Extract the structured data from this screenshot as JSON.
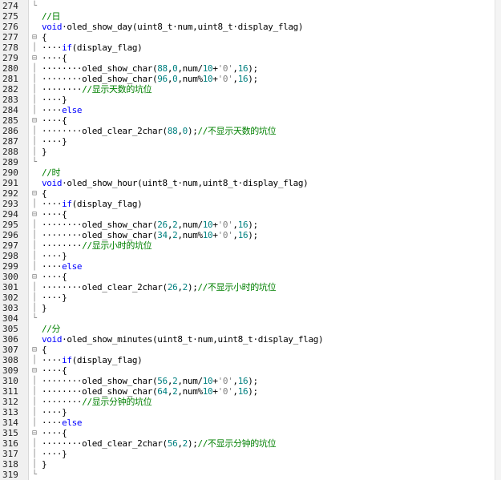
{
  "colors": {
    "keyword": "#0000ff",
    "comment": "#008000",
    "number": "#008080",
    "string": "#808080",
    "text": "#000000",
    "gutter_bg": "#f0f0f0"
  },
  "editor": {
    "lines": [
      {
        "n": "274",
        "fold": "└",
        "tokens": []
      },
      {
        "n": "275",
        "fold": "",
        "tokens": [
          {
            "t": "//日",
            "c": "c"
          }
        ]
      },
      {
        "n": "276",
        "fold": "",
        "tokens": [
          {
            "t": "void",
            "c": "k"
          },
          {
            "t": "·oled_show_day(uint8_t·num,uint8_t·display_flag)",
            "c": "p"
          }
        ]
      },
      {
        "n": "277",
        "fold": "⊟",
        "tokens": [
          {
            "t": "{",
            "c": "p"
          }
        ]
      },
      {
        "n": "278",
        "fold": "│",
        "tokens": [
          {
            "t": "····",
            "c": "p"
          },
          {
            "t": "if",
            "c": "k"
          },
          {
            "t": "(display_flag)",
            "c": "p"
          }
        ]
      },
      {
        "n": "279",
        "fold": "⊟",
        "tokens": [
          {
            "t": "····{",
            "c": "p"
          }
        ]
      },
      {
        "n": "280",
        "fold": "│",
        "tokens": [
          {
            "t": "········oled_show_char(",
            "c": "p"
          },
          {
            "t": "88",
            "c": "n"
          },
          {
            "t": ",",
            "c": "p"
          },
          {
            "t": "0",
            "c": "n"
          },
          {
            "t": ",num/",
            "c": "p"
          },
          {
            "t": "10",
            "c": "n"
          },
          {
            "t": "+",
            "c": "p"
          },
          {
            "t": "'0'",
            "c": "s"
          },
          {
            "t": ",",
            "c": "p"
          },
          {
            "t": "16",
            "c": "n"
          },
          {
            "t": ");",
            "c": "p"
          }
        ]
      },
      {
        "n": "281",
        "fold": "│",
        "tokens": [
          {
            "t": "········oled_show_char(",
            "c": "p"
          },
          {
            "t": "96",
            "c": "n"
          },
          {
            "t": ",",
            "c": "p"
          },
          {
            "t": "0",
            "c": "n"
          },
          {
            "t": ",num%",
            "c": "p"
          },
          {
            "t": "10",
            "c": "n"
          },
          {
            "t": "+",
            "c": "p"
          },
          {
            "t": "'0'",
            "c": "s"
          },
          {
            "t": ",",
            "c": "p"
          },
          {
            "t": "16",
            "c": "n"
          },
          {
            "t": ");",
            "c": "p"
          }
        ]
      },
      {
        "n": "282",
        "fold": "│",
        "tokens": [
          {
            "t": "········",
            "c": "p"
          },
          {
            "t": "//显示天数的坑位",
            "c": "c"
          }
        ]
      },
      {
        "n": "283",
        "fold": "│",
        "tokens": [
          {
            "t": "····}",
            "c": "p"
          }
        ]
      },
      {
        "n": "284",
        "fold": "│",
        "tokens": [
          {
            "t": "····",
            "c": "p"
          },
          {
            "t": "else",
            "c": "k"
          }
        ]
      },
      {
        "n": "285",
        "fold": "⊟",
        "tokens": [
          {
            "t": "····{",
            "c": "p"
          }
        ]
      },
      {
        "n": "286",
        "fold": "│",
        "tokens": [
          {
            "t": "········oled_clear_2char(",
            "c": "p"
          },
          {
            "t": "88",
            "c": "n"
          },
          {
            "t": ",",
            "c": "p"
          },
          {
            "t": "0",
            "c": "n"
          },
          {
            "t": ");",
            "c": "p"
          },
          {
            "t": "//不显示天数的坑位",
            "c": "c"
          }
        ]
      },
      {
        "n": "287",
        "fold": "│",
        "tokens": [
          {
            "t": "····}",
            "c": "p"
          }
        ]
      },
      {
        "n": "288",
        "fold": "│",
        "tokens": [
          {
            "t": "}",
            "c": "p"
          }
        ]
      },
      {
        "n": "289",
        "fold": "└",
        "tokens": []
      },
      {
        "n": "290",
        "fold": "",
        "tokens": [
          {
            "t": "//时",
            "c": "c"
          }
        ]
      },
      {
        "n": "291",
        "fold": "",
        "tokens": [
          {
            "t": "void",
            "c": "k"
          },
          {
            "t": "·oled_show_hour(uint8_t·num,uint8_t·display_flag)",
            "c": "p"
          }
        ]
      },
      {
        "n": "292",
        "fold": "⊟",
        "tokens": [
          {
            "t": "{",
            "c": "p"
          }
        ]
      },
      {
        "n": "293",
        "fold": "│",
        "tokens": [
          {
            "t": "····",
            "c": "p"
          },
          {
            "t": "if",
            "c": "k"
          },
          {
            "t": "(display_flag)",
            "c": "p"
          }
        ]
      },
      {
        "n": "294",
        "fold": "⊟",
        "tokens": [
          {
            "t": "····{",
            "c": "p"
          }
        ]
      },
      {
        "n": "295",
        "fold": "│",
        "tokens": [
          {
            "t": "········oled_show_char(",
            "c": "p"
          },
          {
            "t": "26",
            "c": "n"
          },
          {
            "t": ",",
            "c": "p"
          },
          {
            "t": "2",
            "c": "n"
          },
          {
            "t": ",num/",
            "c": "p"
          },
          {
            "t": "10",
            "c": "n"
          },
          {
            "t": "+",
            "c": "p"
          },
          {
            "t": "'0'",
            "c": "s"
          },
          {
            "t": ",",
            "c": "p"
          },
          {
            "t": "16",
            "c": "n"
          },
          {
            "t": ");",
            "c": "p"
          }
        ]
      },
      {
        "n": "296",
        "fold": "│",
        "tokens": [
          {
            "t": "········oled_show_char(",
            "c": "p"
          },
          {
            "t": "34",
            "c": "n"
          },
          {
            "t": ",",
            "c": "p"
          },
          {
            "t": "2",
            "c": "n"
          },
          {
            "t": ",num%",
            "c": "p"
          },
          {
            "t": "10",
            "c": "n"
          },
          {
            "t": "+",
            "c": "p"
          },
          {
            "t": "'0'",
            "c": "s"
          },
          {
            "t": ",",
            "c": "p"
          },
          {
            "t": "16",
            "c": "n"
          },
          {
            "t": ");",
            "c": "p"
          }
        ]
      },
      {
        "n": "297",
        "fold": "│",
        "tokens": [
          {
            "t": "········",
            "c": "p"
          },
          {
            "t": "//显示小时的坑位",
            "c": "c"
          }
        ]
      },
      {
        "n": "298",
        "fold": "│",
        "tokens": [
          {
            "t": "····}",
            "c": "p"
          }
        ]
      },
      {
        "n": "299",
        "fold": "│",
        "tokens": [
          {
            "t": "····",
            "c": "p"
          },
          {
            "t": "else",
            "c": "k"
          }
        ]
      },
      {
        "n": "300",
        "fold": "⊟",
        "tokens": [
          {
            "t": "····{",
            "c": "p"
          }
        ]
      },
      {
        "n": "301",
        "fold": "│",
        "tokens": [
          {
            "t": "········oled_clear_2char(",
            "c": "p"
          },
          {
            "t": "26",
            "c": "n"
          },
          {
            "t": ",",
            "c": "p"
          },
          {
            "t": "2",
            "c": "n"
          },
          {
            "t": ");",
            "c": "p"
          },
          {
            "t": "//不显示小时的坑位",
            "c": "c"
          }
        ]
      },
      {
        "n": "302",
        "fold": "│",
        "tokens": [
          {
            "t": "····}",
            "c": "p"
          }
        ]
      },
      {
        "n": "303",
        "fold": "│",
        "tokens": [
          {
            "t": "}",
            "c": "p"
          }
        ]
      },
      {
        "n": "304",
        "fold": "└",
        "tokens": []
      },
      {
        "n": "305",
        "fold": "",
        "tokens": [
          {
            "t": "//分",
            "c": "c"
          }
        ]
      },
      {
        "n": "306",
        "fold": "",
        "tokens": [
          {
            "t": "void",
            "c": "k"
          },
          {
            "t": "·oled_show_minutes(uint8_t·num,uint8_t·display_flag)",
            "c": "p"
          }
        ]
      },
      {
        "n": "307",
        "fold": "⊟",
        "tokens": [
          {
            "t": "{",
            "c": "p"
          }
        ]
      },
      {
        "n": "308",
        "fold": "│",
        "tokens": [
          {
            "t": "····",
            "c": "p"
          },
          {
            "t": "if",
            "c": "k"
          },
          {
            "t": "(display_flag)",
            "c": "p"
          }
        ]
      },
      {
        "n": "309",
        "fold": "⊟",
        "tokens": [
          {
            "t": "····{",
            "c": "p"
          }
        ]
      },
      {
        "n": "310",
        "fold": "│",
        "tokens": [
          {
            "t": "········oled_show_char(",
            "c": "p"
          },
          {
            "t": "56",
            "c": "n"
          },
          {
            "t": ",",
            "c": "p"
          },
          {
            "t": "2",
            "c": "n"
          },
          {
            "t": ",num/",
            "c": "p"
          },
          {
            "t": "10",
            "c": "n"
          },
          {
            "t": "+",
            "c": "p"
          },
          {
            "t": "'0'",
            "c": "s"
          },
          {
            "t": ",",
            "c": "p"
          },
          {
            "t": "16",
            "c": "n"
          },
          {
            "t": ");",
            "c": "p"
          }
        ]
      },
      {
        "n": "311",
        "fold": "│",
        "tokens": [
          {
            "t": "········oled_show_char(",
            "c": "p"
          },
          {
            "t": "64",
            "c": "n"
          },
          {
            "t": ",",
            "c": "p"
          },
          {
            "t": "2",
            "c": "n"
          },
          {
            "t": ",num%",
            "c": "p"
          },
          {
            "t": "10",
            "c": "n"
          },
          {
            "t": "+",
            "c": "p"
          },
          {
            "t": "'0'",
            "c": "s"
          },
          {
            "t": ",",
            "c": "p"
          },
          {
            "t": "16",
            "c": "n"
          },
          {
            "t": ");",
            "c": "p"
          }
        ]
      },
      {
        "n": "312",
        "fold": "│",
        "tokens": [
          {
            "t": "········",
            "c": "p"
          },
          {
            "t": "//显示分钟的坑位",
            "c": "c"
          }
        ]
      },
      {
        "n": "313",
        "fold": "│",
        "tokens": [
          {
            "t": "····}",
            "c": "p"
          }
        ]
      },
      {
        "n": "314",
        "fold": "│",
        "tokens": [
          {
            "t": "····",
            "c": "p"
          },
          {
            "t": "else",
            "c": "k"
          }
        ]
      },
      {
        "n": "315",
        "fold": "⊟",
        "tokens": [
          {
            "t": "····{",
            "c": "p"
          }
        ]
      },
      {
        "n": "316",
        "fold": "│",
        "tokens": [
          {
            "t": "········oled_clear_2char(",
            "c": "p"
          },
          {
            "t": "56",
            "c": "n"
          },
          {
            "t": ",",
            "c": "p"
          },
          {
            "t": "2",
            "c": "n"
          },
          {
            "t": ");",
            "c": "p"
          },
          {
            "t": "//不显示分钟的坑位",
            "c": "c"
          }
        ]
      },
      {
        "n": "317",
        "fold": "│",
        "tokens": [
          {
            "t": "····}",
            "c": "p"
          }
        ]
      },
      {
        "n": "318",
        "fold": "│",
        "tokens": [
          {
            "t": "}",
            "c": "p"
          }
        ]
      },
      {
        "n": "319",
        "fold": "└",
        "tokens": []
      }
    ]
  }
}
